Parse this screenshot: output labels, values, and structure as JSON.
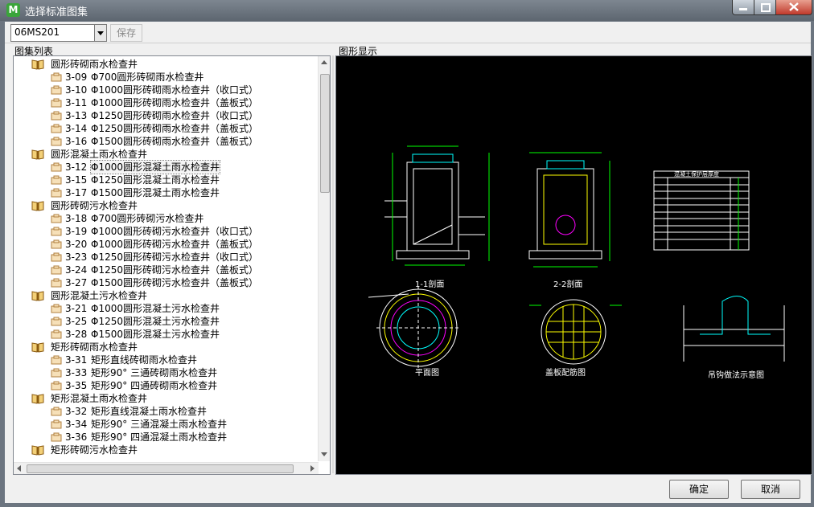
{
  "window": {
    "title": "选择标准图集",
    "app_icon_letter": "M"
  },
  "toolbar": {
    "atlas_value": "06MS201",
    "save_label": "保存"
  },
  "labels": {
    "tree_panel": "图集列表",
    "preview_panel": "图形显示"
  },
  "tree": {
    "groups": [
      {
        "label": "圆形砖砌雨水检查井",
        "items": [
          {
            "code": "3-09",
            "name": "Φ700圆形砖砌雨水检查井"
          },
          {
            "code": "3-10",
            "name": "Φ1000圆形砖砌雨水检查井（收口式）"
          },
          {
            "code": "3-11",
            "name": "Φ1000圆形砖砌雨水检查井（盖板式）"
          },
          {
            "code": "3-13",
            "name": "Φ1250圆形砖砌雨水检查井（收口式）"
          },
          {
            "code": "3-14",
            "name": "Φ1250圆形砖砌雨水检查井（盖板式）"
          },
          {
            "code": "3-16",
            "name": "Φ1500圆形砖砌雨水检查井（盖板式）"
          }
        ]
      },
      {
        "label": "圆形混凝土雨水检查井",
        "items": [
          {
            "code": "3-12",
            "name": "Φ1000圆形混凝土雨水检查井"
          },
          {
            "code": "3-15",
            "name": "Φ1250圆形混凝土雨水检查井"
          },
          {
            "code": "3-17",
            "name": "Φ1500圆形混凝土雨水检查井"
          }
        ]
      },
      {
        "label": "圆形砖砌污水检查井",
        "items": [
          {
            "code": "3-18",
            "name": "Φ700圆形砖砌污水检查井"
          },
          {
            "code": "3-19",
            "name": "Φ1000圆形砖砌污水检查井（收口式）"
          },
          {
            "code": "3-20",
            "name": "Φ1000圆形砖砌污水检查井（盖板式）"
          },
          {
            "code": "3-23",
            "name": "Φ1250圆形砖砌污水检查井（收口式）"
          },
          {
            "code": "3-24",
            "name": "Φ1250圆形砖砌污水检查井（盖板式）"
          },
          {
            "code": "3-27",
            "name": "Φ1500圆形砖砌污水检查井（盖板式）"
          }
        ]
      },
      {
        "label": "圆形混凝土污水检查井",
        "items": [
          {
            "code": "3-21",
            "name": "Φ1000圆形混凝土污水检查井"
          },
          {
            "code": "3-25",
            "name": "Φ1250圆形混凝土污水检查井"
          },
          {
            "code": "3-28",
            "name": "Φ1500圆形混凝土污水检查井"
          }
        ]
      },
      {
        "label": "矩形砖砌雨水检查井",
        "items": [
          {
            "code": "3-31",
            "name": "矩形直线砖砌雨水检查井"
          },
          {
            "code": "3-33",
            "name": "矩形90° 三通砖砌雨水检查井"
          },
          {
            "code": "3-35",
            "name": "矩形90° 四通砖砌雨水检查井"
          }
        ]
      },
      {
        "label": "矩形混凝土雨水检查井",
        "items": [
          {
            "code": "3-32",
            "name": "矩形直线混凝土雨水检查井"
          },
          {
            "code": "3-34",
            "name": "矩形90° 三通混凝土雨水检查井"
          },
          {
            "code": "3-36",
            "name": "矩形90° 四通混凝土雨水检查井"
          }
        ]
      },
      {
        "label": "矩形砖砌污水检查井",
        "items": []
      }
    ],
    "selected": "3-12"
  },
  "preview": {
    "captions": {
      "section_1": "1-1剖面",
      "section_2": "2-2剖面",
      "plan": "平面图",
      "cover": "盖板配筋图",
      "hook": "吊钩做法示意图",
      "table_title": "混凝土保护层厚度"
    },
    "colors": {
      "line": "#ffffff",
      "dim": "#00ff00",
      "cyan": "#00ffff",
      "magenta": "#ff00ff",
      "yellow": "#ffff00"
    }
  },
  "buttons": {
    "ok": "确定",
    "cancel": "取消"
  }
}
